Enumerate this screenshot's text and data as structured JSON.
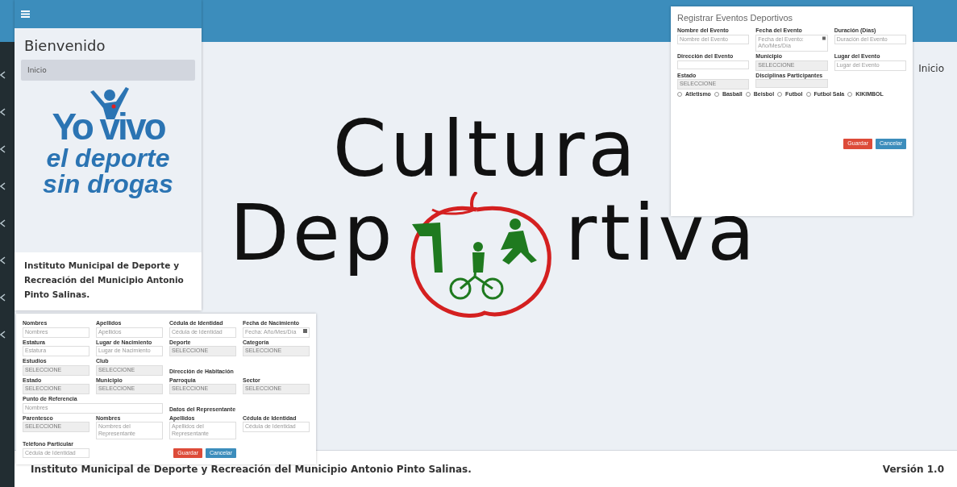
{
  "main": {
    "breadcrumb": "Inicio"
  },
  "hero": {
    "line_1": "Cultura",
    "line_2_before": "Dep",
    "line_2_after": "rtiva"
  },
  "footer": {
    "text": "Instituto Municipal de Deporte y Recreación del Municipio Antonio Pinto Salinas.",
    "version": "Versión 1.0"
  },
  "mobile_view": {
    "heading": "Bienvenido",
    "breadcrumb": "Inicio",
    "logo_lines": [
      "Yo vivo",
      "el deporte",
      "sin drogas"
    ],
    "footer_text": "Instituto Municipal de Deporte y Recreación del Municipio Antonio Pinto Salinas."
  },
  "event_form": {
    "title": "Registrar Eventos Deportivos",
    "fields": [
      {
        "kind": "text",
        "label": "Nombre del Evento",
        "placeholder": "Nombre del Evento"
      },
      {
        "kind": "date",
        "label": "Fecha del Evento",
        "placeholder": "Fecha del Evento: Año/Mes/Día"
      },
      {
        "kind": "text",
        "label": "Duración (Días)",
        "placeholder": "Duración del Evento"
      },
      {
        "kind": "text",
        "label": "Dirección del Evento"
      },
      {
        "kind": "select",
        "label": "Municipio",
        "value": "SELECCIONE"
      },
      {
        "kind": "text",
        "label": "Lugar del Evento",
        "placeholder": "Lugar del Evento"
      },
      {
        "kind": "select",
        "label": "Estado",
        "value": "SELECCIONE"
      },
      {
        "kind": "select",
        "label": "Disciplinas Participantes"
      }
    ],
    "options": [
      {
        "label": "Atletismo",
        "checked": false
      },
      {
        "label": "Basball",
        "checked": false
      },
      {
        "label": "Beisbol",
        "checked": false
      },
      {
        "label": "Futbol",
        "checked": false
      },
      {
        "label": "Futbol Sala",
        "checked": false
      },
      {
        "label": "KIKIMBOL",
        "checked": false
      }
    ],
    "buttons": [
      {
        "label": "Guardar",
        "kind": "danger"
      },
      {
        "label": "Cancelar",
        "kind": "primary"
      }
    ]
  },
  "athlete_form": {
    "fields": [
      {
        "kind": "text",
        "label": "Nombres",
        "placeholder": "Nombres"
      },
      {
        "kind": "text",
        "label": "Apellidos",
        "placeholder": "Apellidos"
      },
      {
        "kind": "text",
        "label": "Cédula de Identidad",
        "placeholder": "Cédula de Identidad"
      },
      {
        "kind": "date",
        "label": "Fecha de Nacimiento",
        "placeholder": "Fecha: Año/Mes/Día"
      },
      {
        "kind": "text",
        "label": "Estatura",
        "placeholder": "Estatura"
      },
      {
        "kind": "text",
        "label": "Lugar de Nacimiento",
        "placeholder": "Lugar de Nacimiento"
      },
      {
        "kind": "select",
        "label": "Deporte",
        "value": "SELECCIONE"
      },
      {
        "kind": "select",
        "label": "Categoría",
        "value": "SELECCIONE"
      },
      {
        "kind": "select",
        "label": "Estudios",
        "value": "SELECCIONE"
      },
      {
        "kind": "select",
        "label": "Club",
        "value": "SELECCIONE"
      },
      {
        "kind": "heading",
        "label": "Dirección de Habitación"
      },
      {
        "kind": "select",
        "label": "Estado",
        "value": "SELECCIONE"
      },
      {
        "kind": "select",
        "label": "Municipio",
        "value": "SELECCIONE"
      },
      {
        "kind": "select",
        "label": "Parroquia",
        "value": "SELECCIONE"
      },
      {
        "kind": "select",
        "label": "Sector",
        "value": "SELECCIONE"
      },
      {
        "kind": "wide_text",
        "label": "Punto de Referencia",
        "placeholder": "Nombres"
      },
      {
        "kind": "heading",
        "label": "Datos del Representante"
      },
      {
        "kind": "select",
        "label": "Parentesco",
        "value": "SELECCIONE"
      },
      {
        "kind": "text",
        "label": "Nombres",
        "placeholder": "Nombres del Representante"
      },
      {
        "kind": "text",
        "label": "Apellidos",
        "placeholder": "Apellidos del Representante"
      },
      {
        "kind": "text",
        "label": "Cédula de Identidad",
        "placeholder": "Cédula de Identidad"
      },
      {
        "kind": "text",
        "label": "Teléfono Particular",
        "placeholder": "Cédula de Identidad"
      }
    ],
    "buttons": [
      {
        "label": "Guardar",
        "kind": "danger"
      },
      {
        "label": "Cancelar",
        "kind": "primary"
      }
    ]
  }
}
